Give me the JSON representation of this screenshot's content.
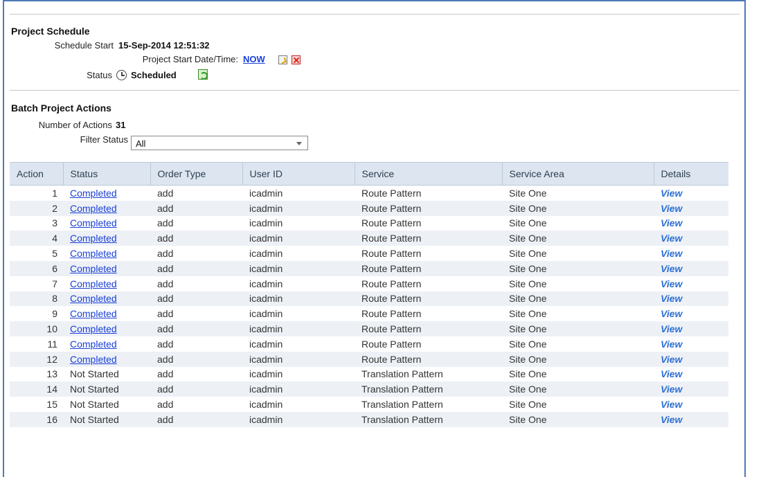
{
  "project_schedule": {
    "title": "Project Schedule",
    "schedule_start_label": "Schedule Start",
    "schedule_start_value": "15-Sep-2014 12:51:32",
    "start_datetime_label": "Project Start Date/Time:",
    "start_datetime_link": "NOW",
    "status_label": "Status",
    "status_value": "Scheduled"
  },
  "batch_actions": {
    "title": "Batch Project Actions",
    "count_label": "Number of Actions",
    "count_value": "31",
    "filter_label": "Filter Status",
    "filter_selected": "All"
  },
  "table": {
    "columns": [
      "Action",
      "Status",
      "Order Type",
      "User ID",
      "Service",
      "Service Area",
      "Details"
    ],
    "rows": [
      {
        "action": "1",
        "status": "Completed",
        "status_link": true,
        "order_type": "add",
        "user_id": "icadmin",
        "service": "Route Pattern",
        "service_area": "Site One",
        "details": "View"
      },
      {
        "action": "2",
        "status": "Completed",
        "status_link": true,
        "order_type": "add",
        "user_id": "icadmin",
        "service": "Route Pattern",
        "service_area": "Site One",
        "details": "View"
      },
      {
        "action": "3",
        "status": "Completed",
        "status_link": true,
        "order_type": "add",
        "user_id": "icadmin",
        "service": "Route Pattern",
        "service_area": "Site One",
        "details": "View"
      },
      {
        "action": "4",
        "status": "Completed",
        "status_link": true,
        "order_type": "add",
        "user_id": "icadmin",
        "service": "Route Pattern",
        "service_area": "Site One",
        "details": "View"
      },
      {
        "action": "5",
        "status": "Completed",
        "status_link": true,
        "order_type": "add",
        "user_id": "icadmin",
        "service": "Route Pattern",
        "service_area": "Site One",
        "details": "View"
      },
      {
        "action": "6",
        "status": "Completed",
        "status_link": true,
        "order_type": "add",
        "user_id": "icadmin",
        "service": "Route Pattern",
        "service_area": "Site One",
        "details": "View"
      },
      {
        "action": "7",
        "status": "Completed",
        "status_link": true,
        "order_type": "add",
        "user_id": "icadmin",
        "service": "Route Pattern",
        "service_area": "Site One",
        "details": "View"
      },
      {
        "action": "8",
        "status": "Completed",
        "status_link": true,
        "order_type": "add",
        "user_id": "icadmin",
        "service": "Route Pattern",
        "service_area": "Site One",
        "details": "View"
      },
      {
        "action": "9",
        "status": "Completed",
        "status_link": true,
        "order_type": "add",
        "user_id": "icadmin",
        "service": "Route Pattern",
        "service_area": "Site One",
        "details": "View"
      },
      {
        "action": "10",
        "status": "Completed",
        "status_link": true,
        "order_type": "add",
        "user_id": "icadmin",
        "service": "Route Pattern",
        "service_area": "Site One",
        "details": "View"
      },
      {
        "action": "11",
        "status": "Completed",
        "status_link": true,
        "order_type": "add",
        "user_id": "icadmin",
        "service": "Route Pattern",
        "service_area": "Site One",
        "details": "View"
      },
      {
        "action": "12",
        "status": "Completed",
        "status_link": true,
        "order_type": "add",
        "user_id": "icadmin",
        "service": "Route Pattern",
        "service_area": "Site One",
        "details": "View"
      },
      {
        "action": "13",
        "status": "Not Started",
        "status_link": false,
        "order_type": "add",
        "user_id": "icadmin",
        "service": "Translation Pattern",
        "service_area": "Site One",
        "details": "View"
      },
      {
        "action": "14",
        "status": "Not Started",
        "status_link": false,
        "order_type": "add",
        "user_id": "icadmin",
        "service": "Translation Pattern",
        "service_area": "Site One",
        "details": "View"
      },
      {
        "action": "15",
        "status": "Not Started",
        "status_link": false,
        "order_type": "add",
        "user_id": "icadmin",
        "service": "Translation Pattern",
        "service_area": "Site One",
        "details": "View"
      },
      {
        "action": "16",
        "status": "Not Started",
        "status_link": false,
        "order_type": "add",
        "user_id": "icadmin",
        "service": "Translation Pattern",
        "service_area": "Site One",
        "details": "View"
      }
    ]
  },
  "icons": {
    "start_edit": "edit-icon",
    "start_clear": "delete-icon",
    "status_clock": "clock-icon",
    "status_refresh": "refresh-icon"
  }
}
